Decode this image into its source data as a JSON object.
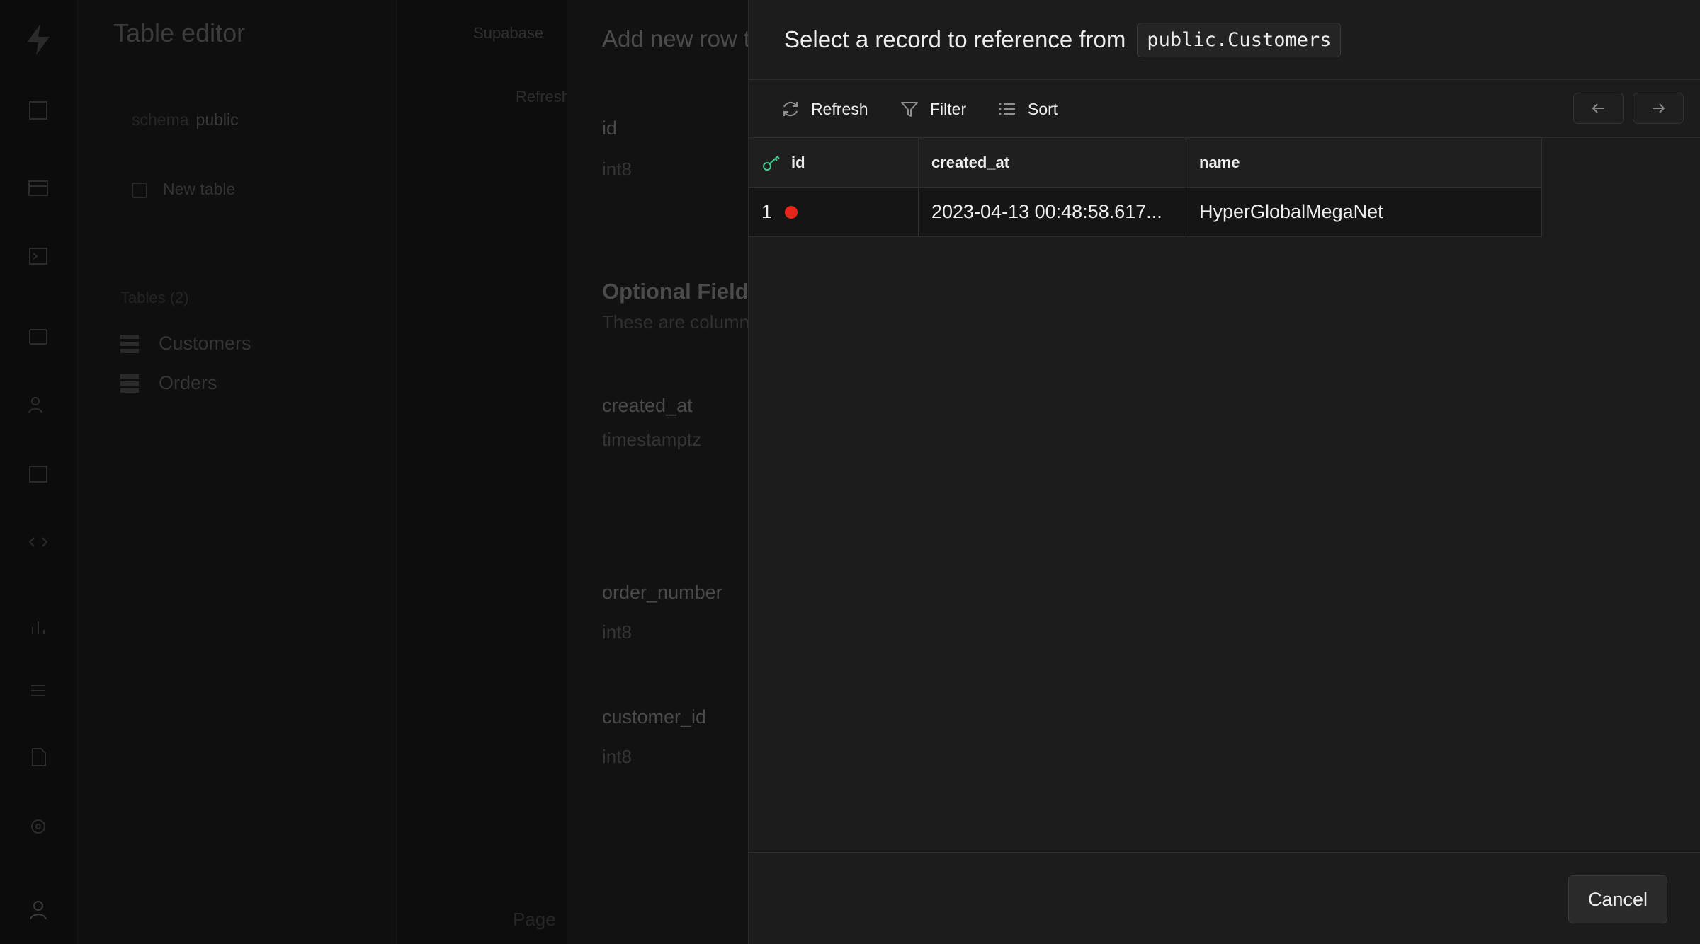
{
  "background": {
    "sidebar": {
      "title": "Table editor",
      "schema_label": "schema",
      "schema_value": "public",
      "new_table": "New table",
      "tables_header": "Tables (2)",
      "tables": [
        "Customers",
        "Orders"
      ]
    },
    "middle": {
      "breadcrumb": "Supabase",
      "refresh": "Refresh",
      "page": "Page"
    },
    "form": {
      "title": "Add new row to Orders",
      "fields_top": [
        {
          "label": "id",
          "type": "int8"
        }
      ],
      "section_title": "Optional Fields",
      "section_sub": "These are columns that",
      "fields": [
        {
          "label": "created_at",
          "type": "timestamptz"
        },
        {
          "label": "order_number",
          "type": "int8"
        },
        {
          "label": "customer_id",
          "type": "int8"
        }
      ]
    }
  },
  "panel": {
    "title": "Select a record to reference from",
    "table_ref": "public.Customers",
    "toolbar": {
      "refresh": "Refresh",
      "filter": "Filter",
      "sort": "Sort"
    },
    "columns": [
      "id",
      "created_at",
      "name"
    ],
    "rows": [
      {
        "id": "1",
        "created_at": "2023-04-13 00:48:58.617...",
        "name": "HyperGlobalMegaNet"
      }
    ],
    "cancel_label": "Cancel"
  },
  "colors": {
    "accent_green": "#3ecf8e",
    "status_dot": "#e5271b"
  }
}
